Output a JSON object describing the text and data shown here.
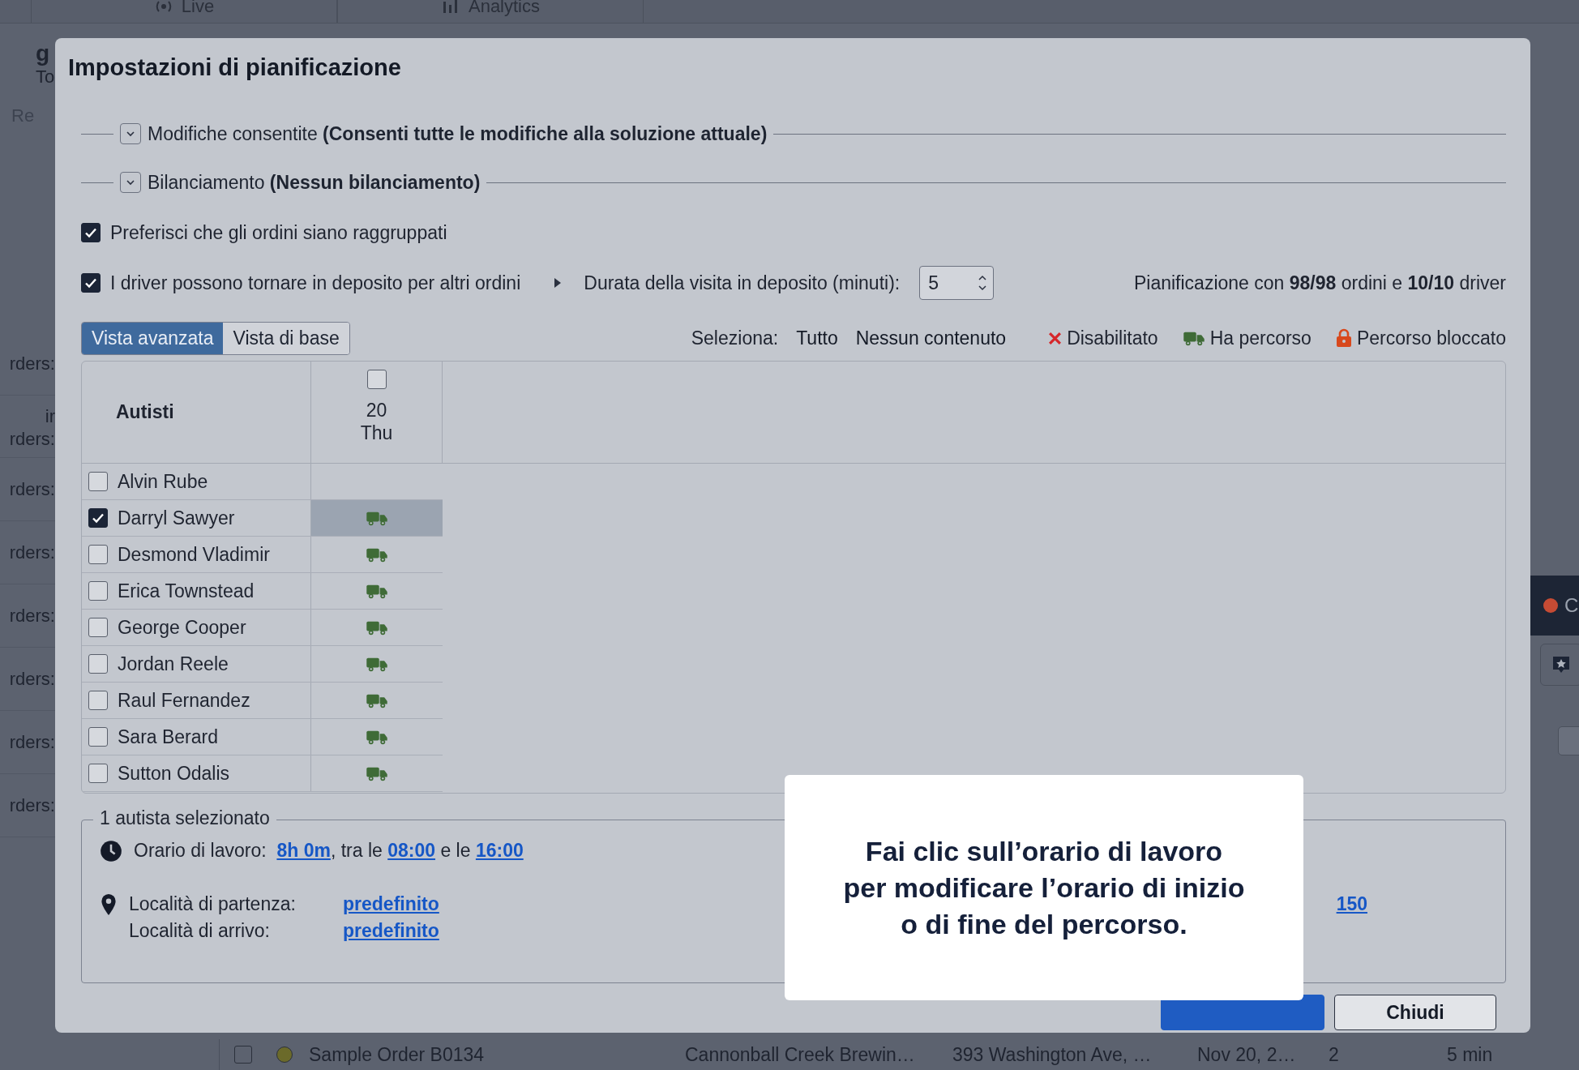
{
  "background": {
    "tabs": [
      {
        "label": "Live"
      },
      {
        "label": "Analytics"
      }
    ],
    "header_texts": [
      "g",
      "To",
      "Re"
    ],
    "side_labels": [
      [
        "rders:"
      ],
      [
        "ir",
        "rders:"
      ],
      [
        "rders:"
      ],
      [
        "rders:"
      ],
      [
        "rders:"
      ],
      [
        "rders:"
      ],
      [
        "rders:"
      ],
      [
        "rders:"
      ]
    ],
    "order_row": {
      "checked": false,
      "color": "#6b6a2a",
      "cells": [
        "Sample Order B0134",
        "Cannonball Creek Brewin…",
        "393 Washington Ave, …",
        "Nov 20, 2…",
        "2",
        "5 min"
      ]
    },
    "right_texts": [
      "C"
    ]
  },
  "dialog": {
    "title": "Impostazioni di pianificazione",
    "sections": [
      {
        "label": "Modifiche consentite **(Consenti tutte le modifiche alla soluzione attuale)**",
        "expanded": false
      },
      {
        "label": "Bilanciamento **(Nessun bilanciamento)**",
        "expanded": false
      }
    ],
    "options": [
      {
        "label": "Preferisci che gli ordini siano raggruppati",
        "checked": true
      },
      {
        "label": "I driver possono tornare in deposito per altri ordini",
        "checked": true
      }
    ],
    "depot": {
      "label": "Durata della visita in deposito (minuti):",
      "value": "5"
    },
    "summary": "Pianificazione con **98/98** ordini e **10/10** driver",
    "views": [
      {
        "label": "Vista avanzata",
        "selected": true
      },
      {
        "label": "Vista di base",
        "selected": false
      }
    ],
    "select": {
      "label": "Seleziona:",
      "links": [
        "Tutto",
        "Nessun contenuto"
      ]
    },
    "legend": [
      {
        "kind": "disabled",
        "label": "Disabilitato"
      },
      {
        "kind": "route",
        "label": "Ha percorso"
      },
      {
        "kind": "locked",
        "label": "Percorso bloccato"
      }
    ],
    "table": {
      "column": "Autisti",
      "day": {
        "checked": false,
        "date": "20",
        "weekday": "Thu"
      },
      "drivers": [
        {
          "name": "Alvin Rube",
          "selected": false,
          "has_route": false
        },
        {
          "name": "Darryl Sawyer",
          "selected": true,
          "has_route": true
        },
        {
          "name": "Desmond Vladimir",
          "selected": false,
          "has_route": true
        },
        {
          "name": "Erica Townstead",
          "selected": false,
          "has_route": true
        },
        {
          "name": "George Cooper",
          "selected": false,
          "has_route": true
        },
        {
          "name": "Jordan Reele",
          "selected": false,
          "has_route": true
        },
        {
          "name": "Raul Fernandez",
          "selected": false,
          "has_route": true
        },
        {
          "name": "Sara Berard",
          "selected": false,
          "has_route": true
        },
        {
          "name": "Sutton Odalis",
          "selected": false,
          "has_route": true
        }
      ]
    },
    "selection": {
      "title": "1 autista selezionato",
      "hours": {
        "label": "Orario di lavoro:",
        "duration": "8h 0m",
        "between": ", tra le",
        "start": "08:00",
        "and": "e le",
        "end": "16:00"
      },
      "start_location": {
        "label": "Località di partenza:",
        "value": "predefinito"
      },
      "end_location": {
        "label": "Località di arrivo:",
        "value": "predefinito"
      },
      "side_link": "150"
    },
    "buttons": [
      {
        "kind": "primary"
      },
      {
        "label": "Chiudi",
        "kind": "secondary"
      }
    ]
  },
  "tooltip": "Fai clic sull’orario di lavoro\nper modificare l’orario di inizio\no di fine del percorso."
}
